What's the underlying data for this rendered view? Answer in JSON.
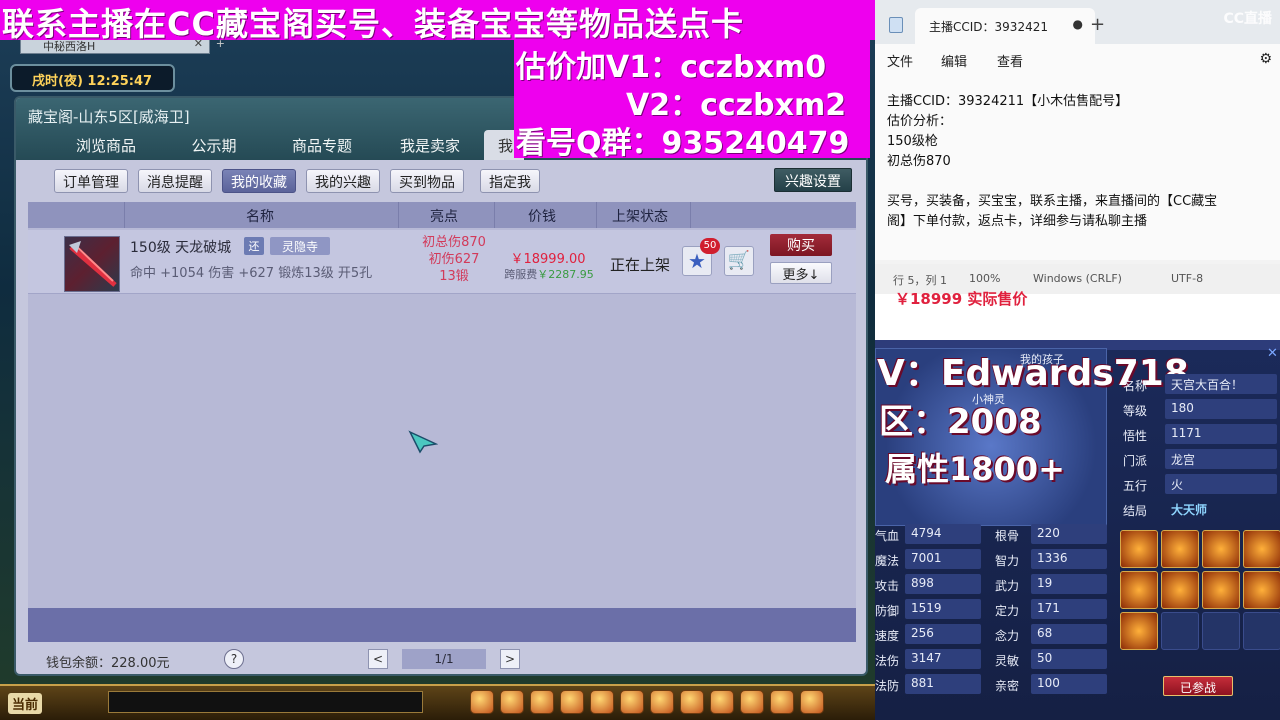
{
  "banner": {
    "title": "联系主播在CC藏宝阁买号、装备宝宝等物品送点卡",
    "line1": "估价加V1：cczbxm0",
    "line2": "V2：cczbxm2",
    "line3": "看号Q群：935240479"
  },
  "game": {
    "tab_title": "中秘西洛H",
    "clock": "戌时(夜)  12:25:47",
    "current_channel": "当前"
  },
  "cbg": {
    "title": "藏宝阁-山东5区[威海卫]",
    "tabs": [
      "浏览商品",
      "公示期",
      "商品专题",
      "我是卖家",
      "我"
    ],
    "sub_buttons": [
      "订单管理",
      "消息提醒",
      "我的收藏",
      "我的兴趣",
      "买到物品",
      "指定我"
    ],
    "interest_settings": "兴趣设置",
    "columns": [
      "名称",
      "亮点",
      "价钱",
      "上架状态"
    ],
    "item": {
      "name": "150级  天龙破城",
      "huan_badge": "还",
      "sect_badge": "灵隐寺",
      "desc": "命中 +1054 伤害 +627 锻炼13级 开5孔",
      "highlights": [
        "初总伤870",
        "初伤627",
        "13锻"
      ],
      "price": "￥18999.00",
      "fee_label": "跨服费",
      "fee_value": "￥2287.95",
      "status": "正在上架",
      "fav_count": "50",
      "buy": "购买",
      "more": "更多↓"
    },
    "wallet": "钱包余额：228.00元",
    "help": "?",
    "page": "1/1",
    "prev": "<",
    "next": ">"
  },
  "notepad": {
    "tab_title": "主播CCID：3932421",
    "tab_dot": "●",
    "new_tab": "+",
    "cc_logo": "CC直播",
    "menu": [
      "文件",
      "编辑",
      "查看"
    ],
    "lines": [
      "主播CCID：39324211【小木估售配号】",
      "估价分析：",
      "150级枪",
      "初总伤870",
      "",
      "买号，买装备，买宝宝，联系主播，来直播间的【CC藏宝",
      "阁】下单付款，返点卡，详细参与请私聊主播"
    ],
    "status": [
      "行 5，列 1",
      "100%",
      "Windows (CRLF)",
      "UTF-8"
    ],
    "under_price": "￥18999 实际售价"
  },
  "char": {
    "overlay_v": "V：Edwards718",
    "overlay_zone": "区：2008",
    "overlay_attr": "属性1800+",
    "pet_label": "我的孩子",
    "sprite_name": "小神灵",
    "info": [
      {
        "label": "名称",
        "value": "天宫大百合！"
      },
      {
        "label": "等级",
        "value": "180"
      },
      {
        "label": "悟性",
        "value": "1171"
      },
      {
        "label": "门派",
        "value": "龙宫"
      },
      {
        "label": "五行",
        "value": "火"
      },
      {
        "label": "结局",
        "value": "大天师"
      }
    ],
    "stats_left": [
      {
        "label": "气血",
        "value": "4794"
      },
      {
        "label": "魔法",
        "value": "7001"
      },
      {
        "label": "攻击",
        "value": "898"
      },
      {
        "label": "防御",
        "value": "1519"
      },
      {
        "label": "速度",
        "value": "256"
      },
      {
        "label": "法伤",
        "value": "3147"
      },
      {
        "label": "法防",
        "value": "881"
      }
    ],
    "stats_right": [
      {
        "label": "根骨",
        "value": "220"
      },
      {
        "label": "智力",
        "value": "1336"
      },
      {
        "label": "武力",
        "value": "19"
      },
      {
        "label": "定力",
        "value": "171"
      },
      {
        "label": "念力",
        "value": "68"
      },
      {
        "label": "灵敏",
        "value": "50"
      },
      {
        "label": "亲密",
        "value": "100"
      }
    ],
    "join_button": "已参战"
  }
}
